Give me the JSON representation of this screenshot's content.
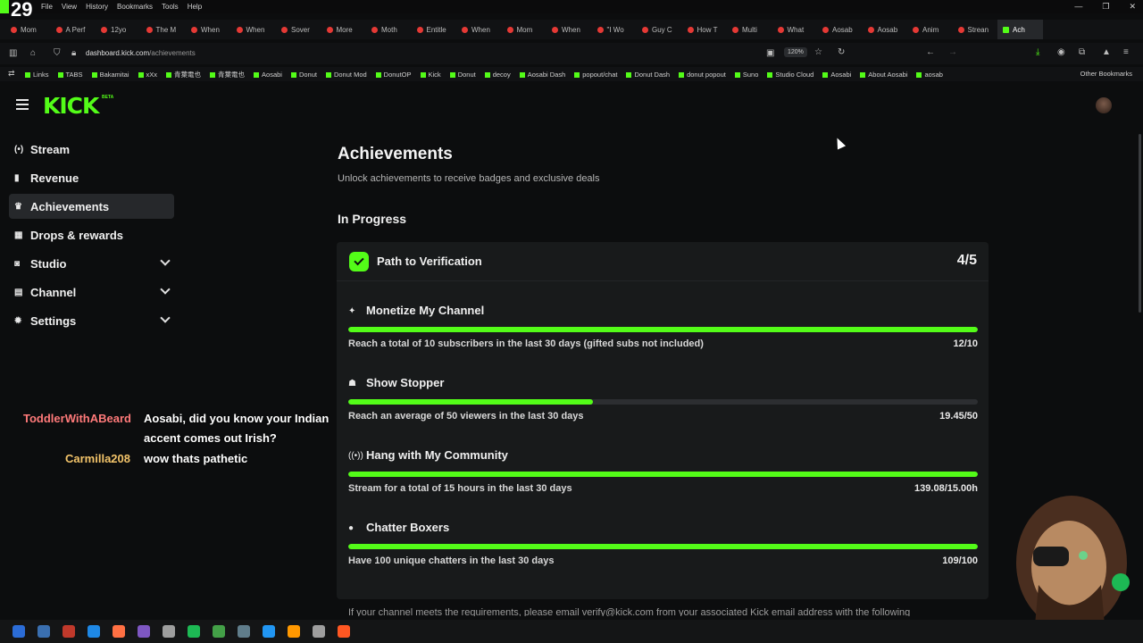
{
  "browser": {
    "menu": [
      "File",
      "View",
      "History",
      "Bookmarks",
      "Tools",
      "Help"
    ],
    "overlay_number": "29",
    "tabs": [
      "Mom",
      "A Perf",
      "12yo",
      "The M",
      "When",
      "When",
      "Sover",
      "More",
      "Moth",
      "Entitle",
      "When",
      "Mom",
      "When",
      "\"I Wo",
      "Guy C",
      "How T",
      "Multi",
      "What",
      "Aosab",
      "Aosab",
      "Anim",
      "Strean",
      "Ach"
    ],
    "url_domain": "dashboard.kick.com",
    "url_path": "/achievements",
    "zoom": "120%",
    "bookmarks": [
      "Links",
      "TABS",
      "Bakamitai",
      "xXx",
      "青葉電也",
      "青葉電也",
      "Aosabi",
      "Donut",
      "Donut Mod",
      "DonutOP",
      "Kick",
      "Donut",
      "decoy",
      "Aosabi Dash",
      "popout/chat",
      "Donut Dash",
      "donut popout",
      "Suno",
      "Studio Cloud",
      "Aosabi",
      "About Aosabi",
      "aosab"
    ],
    "other_bookmarks": "Other Bookmarks"
  },
  "header": {
    "logo": "KICK",
    "beta": "BETA"
  },
  "nav": [
    {
      "label": "Stream",
      "icon": "stream-icon",
      "glyph": "(•)",
      "active": false,
      "expandable": false
    },
    {
      "label": "Revenue",
      "icon": "revenue-icon",
      "glyph": "▮",
      "active": false,
      "expandable": false
    },
    {
      "label": "Achievements",
      "icon": "trophy-icon",
      "glyph": "♛",
      "active": true,
      "expandable": false
    },
    {
      "label": "Drops & rewards",
      "icon": "drops-icon",
      "glyph": "▦",
      "active": false,
      "expandable": false
    },
    {
      "label": "Studio",
      "icon": "studio-icon",
      "glyph": "◙",
      "active": false,
      "expandable": true
    },
    {
      "label": "Channel",
      "icon": "channel-icon",
      "glyph": "▤",
      "active": false,
      "expandable": true
    },
    {
      "label": "Settings",
      "icon": "settings-icon",
      "glyph": "✹",
      "active": false,
      "expandable": true
    }
  ],
  "chat": [
    {
      "user": "ToddlerWithABeard",
      "message": "Aosabi, did you know your Indian",
      "message2": "accent comes out Irish?"
    },
    {
      "user": "Carmilla208",
      "message": "wow thats pathetic"
    }
  ],
  "main": {
    "title": "Achievements",
    "subtitle": "Unlock achievements to receive badges and exclusive deals",
    "section": "In Progress",
    "card": {
      "title": "Path to Verification",
      "progress": "4/5",
      "accent": "#53fc18",
      "achievements": [
        {
          "name": "Monetize My Channel",
          "icon": "sparkle-icon",
          "glyph": "✦",
          "description": "Reach a total of 10 subscribers in the last 30 days (gifted subs not included)",
          "value": "12/10",
          "progress": 1.0
        },
        {
          "name": "Show Stopper",
          "icon": "users-icon",
          "glyph": "☗",
          "description": "Reach an average of 50 viewers in the last 30 days",
          "value": "19.45/50",
          "progress": 0.389
        },
        {
          "name": "Hang with My Community",
          "icon": "broadcast-icon",
          "glyph": "((•))",
          "description": "Stream for a total of 15 hours in the last 30 days",
          "value": "139.08/15.00h",
          "progress": 1.0
        },
        {
          "name": "Chatter Boxers",
          "icon": "chat-bubble-icon",
          "glyph": "●",
          "description": "Have 100 unique chatters in the last 30 days",
          "value": "109/100",
          "progress": 1.0
        }
      ]
    },
    "footer_note": "If your channel meets the requirements, please email verify@kick.com from your associated Kick email address with the following"
  }
}
